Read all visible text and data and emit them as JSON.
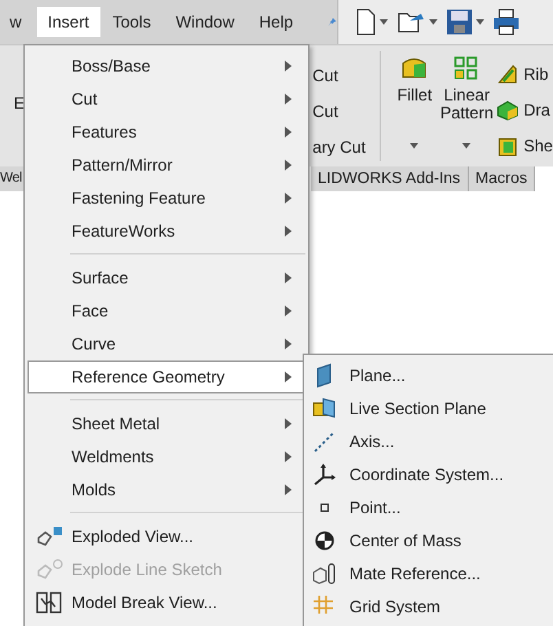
{
  "menubar": {
    "items": [
      {
        "label": "w",
        "selected": false
      },
      {
        "label": "Insert",
        "selected": true
      },
      {
        "label": "Tools",
        "selected": false
      },
      {
        "label": "Window",
        "selected": false
      },
      {
        "label": "Help",
        "selected": false
      }
    ]
  },
  "ribbon": {
    "left_label": "E",
    "cut_items": [
      "Cut",
      "Cut",
      "ary Cut"
    ],
    "tools": [
      {
        "label": "Fillet"
      },
      {
        "label": "Linear Pattern"
      }
    ],
    "small_tools": [
      "Rib",
      "Dra",
      "She"
    ]
  },
  "tabs": [
    {
      "label": "Wel"
    },
    {
      "label": "LIDWORKS Add-Ins"
    },
    {
      "label": "Macros"
    }
  ],
  "menu": {
    "items": [
      {
        "kind": "submenu",
        "label": "Boss/Base",
        "selected": false
      },
      {
        "kind": "submenu",
        "label": "Cut",
        "selected": false
      },
      {
        "kind": "submenu",
        "label": "Features",
        "selected": false
      },
      {
        "kind": "submenu",
        "label": "Pattern/Mirror",
        "selected": false
      },
      {
        "kind": "submenu",
        "label": "Fastening Feature",
        "selected": false
      },
      {
        "kind": "submenu",
        "label": "FeatureWorks",
        "selected": false
      },
      {
        "kind": "separator"
      },
      {
        "kind": "submenu",
        "label": "Surface",
        "selected": false
      },
      {
        "kind": "submenu",
        "label": "Face",
        "selected": false
      },
      {
        "kind": "submenu",
        "label": "Curve",
        "selected": false
      },
      {
        "kind": "submenu",
        "label": "Reference Geometry",
        "selected": true
      },
      {
        "kind": "separator"
      },
      {
        "kind": "submenu",
        "label": "Sheet Metal",
        "selected": false
      },
      {
        "kind": "submenu",
        "label": "Weldments",
        "selected": false
      },
      {
        "kind": "submenu",
        "label": "Molds",
        "selected": false
      },
      {
        "kind": "separator"
      },
      {
        "kind": "command",
        "label": "Exploded View...",
        "disabled": false
      },
      {
        "kind": "command",
        "label": "Explode Line Sketch",
        "disabled": true
      },
      {
        "kind": "command",
        "label": "Model Break View...",
        "disabled": false
      }
    ]
  },
  "submenu": {
    "items": [
      {
        "label": "Plane..."
      },
      {
        "label": "Live Section Plane"
      },
      {
        "label": "Axis..."
      },
      {
        "label": "Coordinate System..."
      },
      {
        "label": "Point..."
      },
      {
        "label": "Center of Mass"
      },
      {
        "label": "Mate Reference..."
      },
      {
        "label": "Grid System"
      }
    ]
  }
}
